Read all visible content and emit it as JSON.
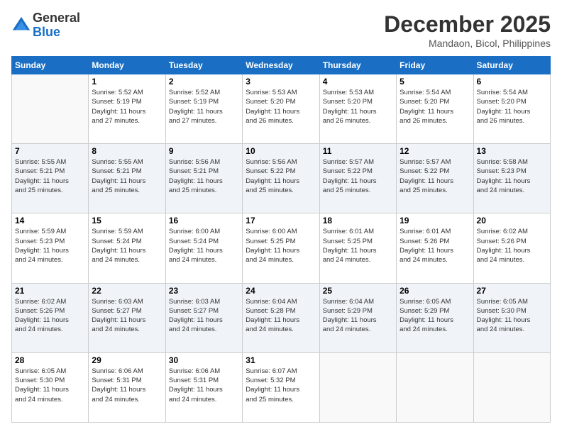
{
  "header": {
    "logo_line1": "General",
    "logo_line2": "Blue",
    "month": "December 2025",
    "location": "Mandaon, Bicol, Philippines"
  },
  "days_of_week": [
    "Sunday",
    "Monday",
    "Tuesday",
    "Wednesday",
    "Thursday",
    "Friday",
    "Saturday"
  ],
  "weeks": [
    [
      {
        "day": "",
        "info": ""
      },
      {
        "day": "1",
        "info": "Sunrise: 5:52 AM\nSunset: 5:19 PM\nDaylight: 11 hours\nand 27 minutes."
      },
      {
        "day": "2",
        "info": "Sunrise: 5:52 AM\nSunset: 5:19 PM\nDaylight: 11 hours\nand 27 minutes."
      },
      {
        "day": "3",
        "info": "Sunrise: 5:53 AM\nSunset: 5:20 PM\nDaylight: 11 hours\nand 26 minutes."
      },
      {
        "day": "4",
        "info": "Sunrise: 5:53 AM\nSunset: 5:20 PM\nDaylight: 11 hours\nand 26 minutes."
      },
      {
        "day": "5",
        "info": "Sunrise: 5:54 AM\nSunset: 5:20 PM\nDaylight: 11 hours\nand 26 minutes."
      },
      {
        "day": "6",
        "info": "Sunrise: 5:54 AM\nSunset: 5:20 PM\nDaylight: 11 hours\nand 26 minutes."
      }
    ],
    [
      {
        "day": "7",
        "info": "Sunrise: 5:55 AM\nSunset: 5:21 PM\nDaylight: 11 hours\nand 25 minutes."
      },
      {
        "day": "8",
        "info": "Sunrise: 5:55 AM\nSunset: 5:21 PM\nDaylight: 11 hours\nand 25 minutes."
      },
      {
        "day": "9",
        "info": "Sunrise: 5:56 AM\nSunset: 5:21 PM\nDaylight: 11 hours\nand 25 minutes."
      },
      {
        "day": "10",
        "info": "Sunrise: 5:56 AM\nSunset: 5:22 PM\nDaylight: 11 hours\nand 25 minutes."
      },
      {
        "day": "11",
        "info": "Sunrise: 5:57 AM\nSunset: 5:22 PM\nDaylight: 11 hours\nand 25 minutes."
      },
      {
        "day": "12",
        "info": "Sunrise: 5:57 AM\nSunset: 5:22 PM\nDaylight: 11 hours\nand 25 minutes."
      },
      {
        "day": "13",
        "info": "Sunrise: 5:58 AM\nSunset: 5:23 PM\nDaylight: 11 hours\nand 24 minutes."
      }
    ],
    [
      {
        "day": "14",
        "info": "Sunrise: 5:59 AM\nSunset: 5:23 PM\nDaylight: 11 hours\nand 24 minutes."
      },
      {
        "day": "15",
        "info": "Sunrise: 5:59 AM\nSunset: 5:24 PM\nDaylight: 11 hours\nand 24 minutes."
      },
      {
        "day": "16",
        "info": "Sunrise: 6:00 AM\nSunset: 5:24 PM\nDaylight: 11 hours\nand 24 minutes."
      },
      {
        "day": "17",
        "info": "Sunrise: 6:00 AM\nSunset: 5:25 PM\nDaylight: 11 hours\nand 24 minutes."
      },
      {
        "day": "18",
        "info": "Sunrise: 6:01 AM\nSunset: 5:25 PM\nDaylight: 11 hours\nand 24 minutes."
      },
      {
        "day": "19",
        "info": "Sunrise: 6:01 AM\nSunset: 5:26 PM\nDaylight: 11 hours\nand 24 minutes."
      },
      {
        "day": "20",
        "info": "Sunrise: 6:02 AM\nSunset: 5:26 PM\nDaylight: 11 hours\nand 24 minutes."
      }
    ],
    [
      {
        "day": "21",
        "info": "Sunrise: 6:02 AM\nSunset: 5:26 PM\nDaylight: 11 hours\nand 24 minutes."
      },
      {
        "day": "22",
        "info": "Sunrise: 6:03 AM\nSunset: 5:27 PM\nDaylight: 11 hours\nand 24 minutes."
      },
      {
        "day": "23",
        "info": "Sunrise: 6:03 AM\nSunset: 5:27 PM\nDaylight: 11 hours\nand 24 minutes."
      },
      {
        "day": "24",
        "info": "Sunrise: 6:04 AM\nSunset: 5:28 PM\nDaylight: 11 hours\nand 24 minutes."
      },
      {
        "day": "25",
        "info": "Sunrise: 6:04 AM\nSunset: 5:29 PM\nDaylight: 11 hours\nand 24 minutes."
      },
      {
        "day": "26",
        "info": "Sunrise: 6:05 AM\nSunset: 5:29 PM\nDaylight: 11 hours\nand 24 minutes."
      },
      {
        "day": "27",
        "info": "Sunrise: 6:05 AM\nSunset: 5:30 PM\nDaylight: 11 hours\nand 24 minutes."
      }
    ],
    [
      {
        "day": "28",
        "info": "Sunrise: 6:05 AM\nSunset: 5:30 PM\nDaylight: 11 hours\nand 24 minutes."
      },
      {
        "day": "29",
        "info": "Sunrise: 6:06 AM\nSunset: 5:31 PM\nDaylight: 11 hours\nand 24 minutes."
      },
      {
        "day": "30",
        "info": "Sunrise: 6:06 AM\nSunset: 5:31 PM\nDaylight: 11 hours\nand 24 minutes."
      },
      {
        "day": "31",
        "info": "Sunrise: 6:07 AM\nSunset: 5:32 PM\nDaylight: 11 hours\nand 25 minutes."
      },
      {
        "day": "",
        "info": ""
      },
      {
        "day": "",
        "info": ""
      },
      {
        "day": "",
        "info": ""
      }
    ]
  ]
}
